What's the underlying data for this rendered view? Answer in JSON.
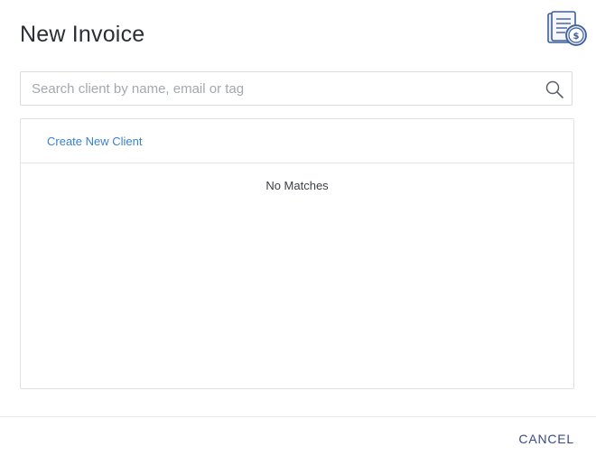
{
  "dialog": {
    "title": "New Invoice",
    "header_icon": "invoice-dollar-icon"
  },
  "search": {
    "placeholder": "Search client by name, email or tag",
    "value": "",
    "icon": "search-icon"
  },
  "results": {
    "create_label": "Create New Client",
    "empty_message": "No Matches"
  },
  "footer": {
    "cancel_label": "CANCEL"
  },
  "colors": {
    "link": "#3b82c9",
    "cancel": "#3a4a8a",
    "title": "#2b2f36",
    "icon_blue": "#3f5f98"
  }
}
